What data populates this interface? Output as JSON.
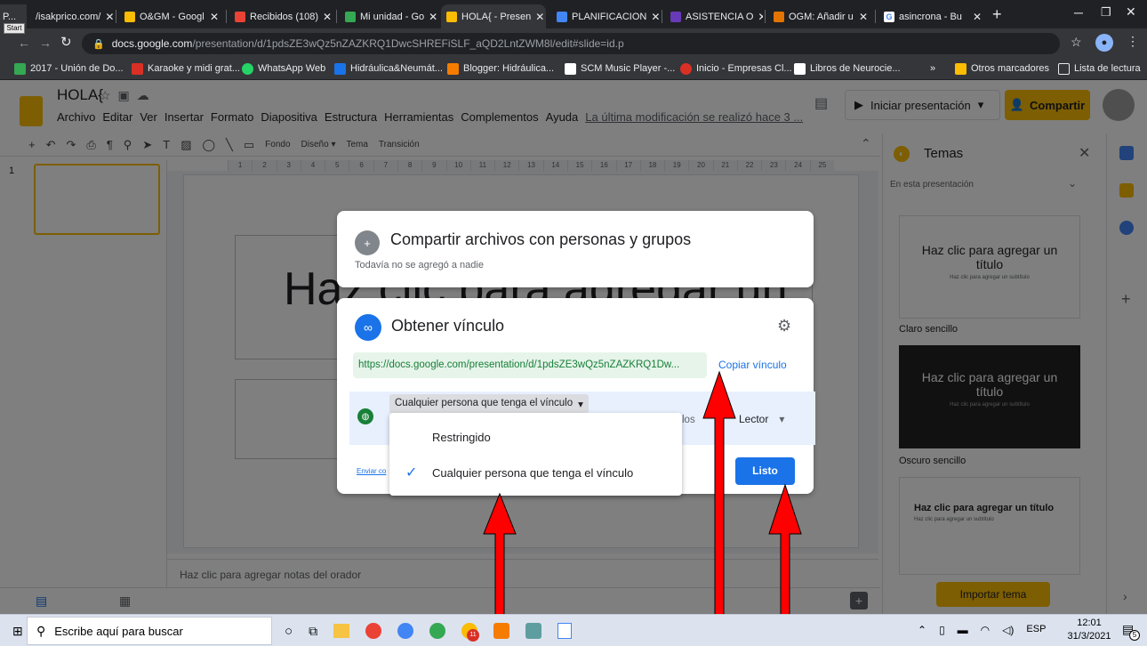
{
  "browser": {
    "tabs": [
      {
        "label": "P...",
        "color": "#e8eaed"
      },
      {
        "label": "/isakprico.com/",
        "color": "#ffffff"
      },
      {
        "label": "O&GM - Googl",
        "color": "#fbbc04"
      },
      {
        "label": "Recibidos (108)",
        "color": "#ea4335"
      },
      {
        "label": "Mi unidad - Go",
        "color": "#34a853"
      },
      {
        "label": "HOLA{ - Presen",
        "color": "#fbbc04"
      },
      {
        "label": "PLANIFICACION",
        "color": "#4285f4"
      },
      {
        "label": "ASISTENCIA O",
        "color": "#673ab7"
      },
      {
        "label": "OGM: Añadir u",
        "color": "#e37400"
      },
      {
        "label": "asincrona - Bu",
        "color": "#4285f4"
      }
    ],
    "start_label": "Start",
    "new_tab": "+",
    "url_host": "docs.google.com",
    "url_path": "/presentation/d/1pdsZE3wQz5nZAZKRQ1DwcSHREFiSLF_aQD2LntZWM8l/edit#slide=id.p",
    "bookmarks": [
      {
        "label": "2017 - Unión de Do...",
        "color": "#34a853"
      },
      {
        "label": "Karaoke y midi grat...",
        "color": "#d93025"
      },
      {
        "label": "WhatsApp Web",
        "color": "#25d366"
      },
      {
        "label": "Hidráulica&Neumát...",
        "color": "#1a73e8"
      },
      {
        "label": "Blogger: Hidráulica...",
        "color": "#f57c00"
      },
      {
        "label": "SCM Music Player -...",
        "color": "#202124"
      },
      {
        "label": "Inicio - Empresas Cl...",
        "color": "#d93025"
      },
      {
        "label": "Libros de Neurocie...",
        "color": "#5f6368"
      }
    ],
    "bookmarks_more": "»",
    "other_bookmarks": "Otros marcadores",
    "reading_list": "Lista de lectura"
  },
  "slides": {
    "title": "HOLA{",
    "menu": [
      "Archivo",
      "Editar",
      "Ver",
      "Insertar",
      "Formato",
      "Diapositiva",
      "Estructura",
      "Herramientas",
      "Complementos",
      "Ayuda"
    ],
    "last_edit": "La última modificación se realizó hace 3 ...",
    "present_label": "Iniciar presentación",
    "share_label": "Compartir",
    "toolbar_text": [
      "Fondo",
      "Diseño ▾",
      "Tema",
      "Transición"
    ],
    "ruler": [
      "1",
      "2",
      "3",
      "4",
      "5",
      "6",
      "7",
      "8",
      "9",
      "10",
      "11",
      "12",
      "13",
      "14",
      "15",
      "16",
      "17",
      "18",
      "19",
      "20",
      "21",
      "22",
      "23",
      "24",
      "25"
    ],
    "slide_number": "1",
    "slide_title_placeholder": "Haz clic para agregar un",
    "notes_placeholder": "Haz clic para agregar notas del orador"
  },
  "themes_panel": {
    "title": "Temas",
    "section": "En esta presentación",
    "themes": [
      {
        "name": "Claro sencillo",
        "preview_title": "Haz clic para agregar un título",
        "preview_sub": "Haz clic para agregar un subtítulo"
      },
      {
        "name": "Oscuro sencillo",
        "preview_title": "Haz clic para agregar un título",
        "preview_sub": "Haz clic para agregar un subtítulo"
      },
      {
        "name": "",
        "preview_title": "Haz clic para agregar un título",
        "preview_sub": "Haz clic para agregar un subtítulo"
      }
    ],
    "import_label": "Importar tema"
  },
  "share_dialog": {
    "title": "Compartir archivos con personas y grupos",
    "subtitle": "Todavía no se agregó a nadie"
  },
  "link_dialog": {
    "title": "Obtener vínculo",
    "link": "https://docs.google.com/presentation/d/1pdsZE3wQz5nZAZKRQ1Dw...",
    "copy_link": "Copiar vínculo",
    "access_selected": "Cualquier persona que tenga el vínculo",
    "access_desc_fragment": "los",
    "role": "Lector",
    "send_feedback": "Enviar co",
    "done": "Listo",
    "menu_options": [
      {
        "label": "Restringido",
        "checked": false
      },
      {
        "label": "Cualquier persona que tenga el vínculo",
        "checked": true
      }
    ]
  },
  "taskbar": {
    "search_placeholder": "Escribe aquí para buscar",
    "language": "ESP",
    "time": "12:01",
    "date": "31/3/2021",
    "notifications": "5",
    "badge": "11"
  },
  "colors": {
    "accent_blue": "#1a73e8",
    "link_green": "#188038",
    "arrow_red": "#ff0000",
    "import_yellow": "#fbbc04"
  }
}
